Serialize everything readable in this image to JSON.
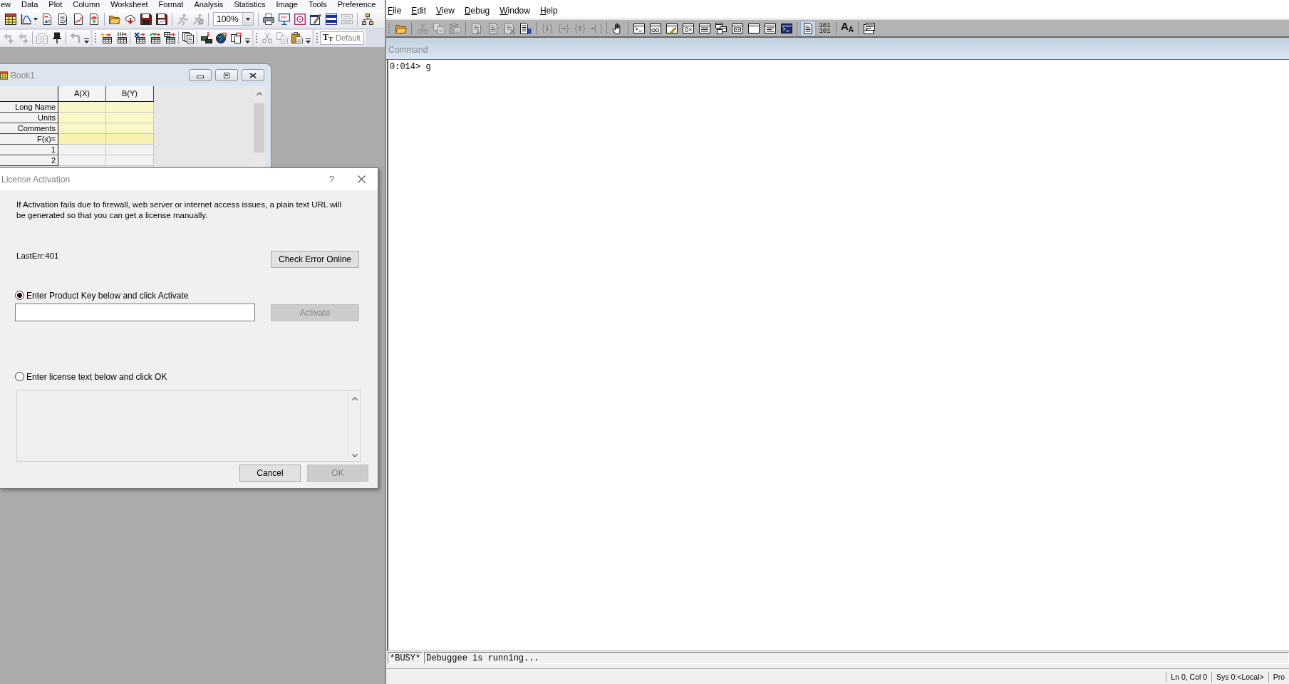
{
  "origin": {
    "menu": [
      "ew",
      "Data",
      "Plot",
      "Column",
      "Worksheet",
      "Format",
      "Analysis",
      "Statistics",
      "Image",
      "Tools",
      "Preference"
    ],
    "standard_toolbar": {
      "items": [
        {
          "kind": "button",
          "disabled": false
        },
        {
          "kind": "button",
          "disabled": false
        },
        {
          "kind": "button",
          "disabled": false
        },
        {
          "kind": "button",
          "disabled": false
        },
        {
          "kind": "button",
          "disabled": false
        },
        {
          "kind": "button",
          "disabled": false
        },
        {
          "kind": "button",
          "disabled": false
        },
        {
          "kind": "button",
          "disabled": false
        },
        {
          "kind": "button",
          "disabled": false
        },
        {
          "kind": "button",
          "disabled": false
        },
        {
          "kind": "button",
          "disabled": true
        },
        {
          "kind": "button",
          "disabled": true
        },
        {
          "kind": "combo",
          "value": "100%"
        },
        {
          "kind": "button",
          "disabled": false
        },
        {
          "kind": "button",
          "disabled": false
        },
        {
          "kind": "button",
          "disabled": false
        },
        {
          "kind": "button",
          "disabled": false
        },
        {
          "kind": "button",
          "disabled": false
        },
        {
          "kind": "button",
          "disabled": true
        },
        {
          "kind": "button",
          "disabled": false
        }
      ]
    },
    "toolbar_row_2": [
      {
        "items": [
          {
            "kind": "button",
            "disabled": true
          },
          {
            "kind": "button",
            "disabled": true
          },
          {
            "kind": "button",
            "disabled": true
          },
          {
            "kind": "button",
            "disabled": false
          },
          {
            "kind": "button",
            "disabled": true
          }
        ]
      },
      {
        "items": [
          {
            "kind": "button",
            "disabled": false
          },
          {
            "kind": "button",
            "disabled": false
          },
          {
            "kind": "button",
            "disabled": false
          },
          {
            "kind": "button",
            "disabled": false
          },
          {
            "kind": "button",
            "disabled": false
          },
          {
            "kind": "button",
            "disabled": false
          },
          {
            "kind": "button",
            "disabled": false
          },
          {
            "kind": "button",
            "disabled": false
          },
          {
            "kind": "button",
            "disabled": false
          }
        ]
      },
      {
        "items": [
          {
            "kind": "button",
            "disabled": true
          },
          {
            "kind": "button",
            "disabled": true
          },
          {
            "kind": "button",
            "disabled": false
          }
        ]
      },
      {
        "items": [
          {
            "kind": "combo",
            "icon_text": "T$_{T}$",
            "value": "Default"
          }
        ]
      }
    ],
    "worksheet": {
      "title": "Book1",
      "columns": [
        "A(X)",
        "B(Y)"
      ],
      "label_rows": [
        "Long Name",
        "Units",
        "Comments",
        "F(x)="
      ],
      "data_rows": [
        "1",
        "2"
      ]
    },
    "dialog": {
      "title": "License Activation",
      "help": "?",
      "message": "If Activation fails due to firewall, web server or internet access issues, a plain text URL will be generated so that you can get a license manually.",
      "error": "LastErr:401",
      "check_button": "Check Error Online",
      "options": [
        {
          "label": "Enter Product Key below and click Activate",
          "selected": true
        },
        {
          "label": "Enter license text below and click OK",
          "selected": false
        }
      ],
      "product_key": {
        "disabled": false
      },
      "activate_button": {
        "label": "Activate",
        "disabled": true
      },
      "license_text": {
        "disabled": true
      },
      "buttons": [
        {
          "label": "Cancel",
          "disabled": false
        },
        {
          "label": "OK",
          "disabled": true
        }
      ]
    }
  },
  "debugger": {
    "menu": [
      "File",
      "Edit",
      "View",
      "Debug",
      "Window",
      "Help"
    ],
    "toolbar": {
      "items": [
        {
          "kind": "button",
          "disabled": false,
          "pressed": false
        },
        {
          "kind": "button",
          "disabled": true,
          "pressed": false
        },
        {
          "kind": "button",
          "disabled": true,
          "pressed": false
        },
        {
          "kind": "button",
          "disabled": true,
          "pressed": false
        },
        {
          "kind": "button",
          "disabled": true,
          "pressed": false
        },
        {
          "kind": "button",
          "disabled": true,
          "pressed": false
        },
        {
          "kind": "button",
          "disabled": true,
          "pressed": false
        },
        {
          "kind": "button",
          "disabled": false,
          "pressed": false
        },
        {
          "kind": "button",
          "disabled": true,
          "pressed": false
        },
        {
          "kind": "button",
          "disabled": true,
          "pressed": false
        },
        {
          "kind": "button",
          "disabled": true,
          "pressed": false
        },
        {
          "kind": "button",
          "disabled": true,
          "pressed": false
        },
        {
          "kind": "button",
          "disabled": false,
          "pressed": false
        },
        {
          "kind": "button",
          "disabled": false,
          "pressed": false
        },
        {
          "kind": "button",
          "disabled": false,
          "pressed": false
        },
        {
          "kind": "button",
          "disabled": false,
          "pressed": false
        },
        {
          "kind": "button",
          "disabled": false,
          "pressed": false
        },
        {
          "kind": "button",
          "disabled": false,
          "pressed": false
        },
        {
          "kind": "button",
          "disabled": false,
          "pressed": false
        },
        {
          "kind": "button",
          "disabled": false,
          "pressed": false
        },
        {
          "kind": "button",
          "disabled": false,
          "pressed": false
        },
        {
          "kind": "button",
          "disabled": false,
          "pressed": false
        },
        {
          "kind": "button",
          "disabled": false,
          "pressed": false
        },
        {
          "kind": "button",
          "disabled": false,
          "pressed": true
        },
        {
          "kind": "text",
          "label": "101 101",
          "disabled": false,
          "pressed": false
        },
        {
          "kind": "text",
          "label": "A$_{A}$",
          "disabled": false,
          "pressed": false
        },
        {
          "kind": "button",
          "disabled": false,
          "pressed": false
        }
      ]
    },
    "pane_title": "Command",
    "output": [
      "0:014> g"
    ],
    "busy": "*BUSY*",
    "busy_message": "Debuggee is running...",
    "status": [
      "Ln 0, Col 0",
      "Sys 0:<Local>",
      "Pro"
    ]
  }
}
